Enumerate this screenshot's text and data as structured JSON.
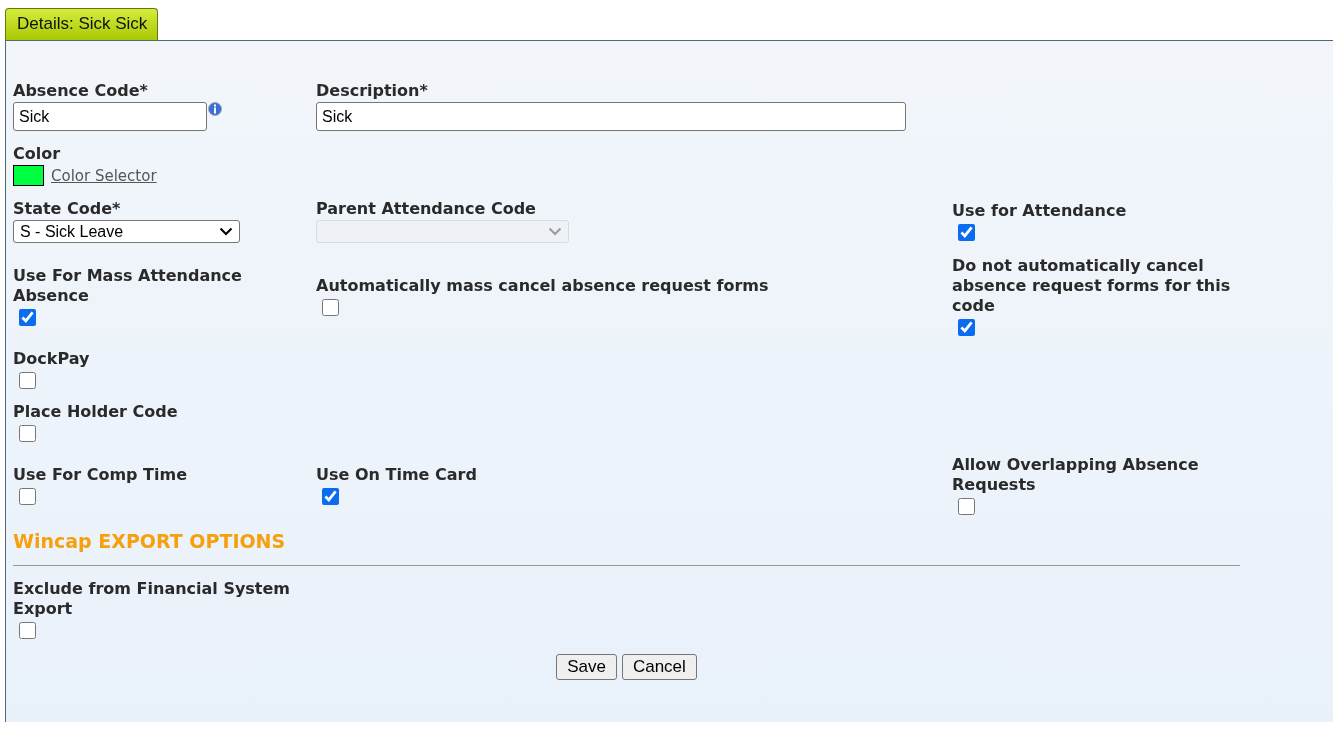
{
  "tab": {
    "label": "Details: Sick Sick",
    "selected": true
  },
  "rows": [
    [
      {
        "kind": "text",
        "label": "Absence Code*",
        "value": "Sick",
        "info": true
      },
      {
        "kind": "text",
        "label": "Description*",
        "value": "Sick"
      }
    ],
    [
      {
        "kind": "color",
        "label": "Color",
        "color": "#00ff40",
        "link": "Color Selector"
      }
    ],
    [
      {
        "kind": "select",
        "label": "State Code*",
        "value": "S - Sick Leave",
        "disabled": false
      },
      {
        "kind": "select",
        "label": "Parent Attendance Code",
        "disabled": true
      },
      {
        "kind": "checkbox",
        "label": "Use for Attendance",
        "checked": true
      }
    ],
    [
      {
        "kind": "checkbox",
        "label": "Use For Mass Attendance Absence",
        "checked": true
      },
      {
        "kind": "checkbox",
        "label": "Automatically mass cancel absence request forms",
        "checked": false
      },
      {
        "kind": "checkbox",
        "label": "Do not automatically cancel absence request forms for this code",
        "checked": true
      }
    ],
    [
      {
        "kind": "checkbox",
        "label": "DockPay",
        "checked": false
      }
    ],
    [
      {
        "kind": "checkbox",
        "label": "Place Holder Code",
        "checked": false
      }
    ],
    [
      {
        "kind": "checkbox",
        "label": "Use For Comp Time",
        "checked": false
      },
      {
        "kind": "checkbox",
        "label": "Use On Time Card",
        "checked": true
      },
      {
        "kind": "checkbox",
        "label": "Allow Overlapping Absence Requests",
        "checked": false
      }
    ]
  ],
  "section": {
    "title": "Wincap EXPORT OPTIONS",
    "rows": [
      [
        {
          "kind": "checkbox",
          "label": "Exclude from Financial System Export",
          "checked": false
        }
      ]
    ]
  },
  "buttons": [
    "Save",
    "Cancel"
  ]
}
